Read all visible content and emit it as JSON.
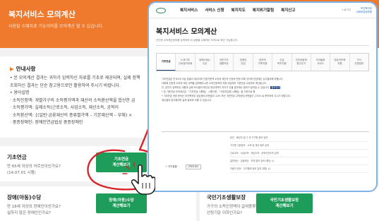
{
  "background_page": {
    "header": {
      "title": "복지서비스 모의계산",
      "subtitle": "사용할 수혜자료 기능이며를 모의계산 할 수 있습니다."
    },
    "guide": {
      "title": "안내사항",
      "lines": [
        "• 본 모의계산 결과는 귀하가 입력하신 자료를 기초로 제공되며, 실제 정책",
        "  조회하신 결과는 단순 참고용으로만 활용하여 주시기 바랍니다.",
        "• 용어설명",
        "  · 소득인정액: 개별가구의 소득평가액과 재산의 소득환산액을 합산한 금",
        "  · 소득평가액: 실제소득(근로소득, 사업소득, 재산소득, 공적이",
        "  · 소득환산액: {(일반·금융재산의 종류별가액 – 기본재산액 – 부채) ×",
        "  · 중증장애인: 장애인연금법상 중증장애인"
      ]
    },
    "cards": [
      {
        "title": "기초연금",
        "desc": "만 65세 이상의 어르신이신가요?\n(14.07.01 시행)",
        "button": "기초연금\n계산해보기"
      },
      {
        "title": "장애(아동)수당",
        "desc": "만 18세 이상의 장애인이신가요?\n실하지 않은 장애인인가요?",
        "button": "장애(아동)수당\n계산해보기"
      },
      {
        "title": "국민기초생활보장",
        "desc": "가구의 소득인정액이 급여종류별\n선정기준 이하인가요?",
        "button": "국민기초생활보장\n계산해보기"
      }
    ]
  },
  "popup": {
    "nav": [
      "복지서비스",
      "서비스 신청",
      "복지지도",
      "복지위기알림",
      "복지신고"
    ],
    "util": "+로그인",
    "brand": "보건복지부\n사회보장정보원",
    "title": "복지서비스 모의계산",
    "subtitle": "간단한 소득재산정보를 입력하여 내 상황을 수혜여부 자격으로 확인 가능합니다.",
    "tabs": [
      "기초연금",
      "노후기초\n근로장려세제",
      "장애(아동)\n수당",
      "국민기초\n생활보장",
      "장애인\n연금",
      "한부모\n가족지원",
      "긴급\n복지지원",
      "주민공동체\n청년주거",
      "아이돌봄\n서비스",
      "영유아보육\n지원",
      "가사\n간병방문"
    ],
    "active_tab": 0,
    "notes": [
      "기초연금은 만 65세 이상 분들이 대상이며 선정기준액 소득과 재산의 인정하 판정 아래 것이며 연금액은 심사결과에 따릅니다.",
      "아래에 선정액 소득과 재산 내역을 입력해주시면 소득인정액과 지원 대상여부 기준연금 수령여부 계산됩니다.",
      "단, 본인이 입력하신 내용과 실제 조사결과 확인된 재산내역이 차이가 있을 경우에는 결과가 달라질 수 있습니다.",
      "* 본 기준연금 모의계산은 「기초연금 시행령」 시행기준,  「국민연금법 시행령」을 기준으로 함",
      "* 기초연금 관련 문의는 보건복지부 상담센터(국번없이 129) 또는 국민연금 고객센터(국번없이 1355) 로 문의하여 주시기 바랍니다.",
      "계산결과 참고용이며 실제 결과와 다를 수 있습니다."
    ],
    "note_highlight": "중요안내",
    "form_rows": [
      "본인 · 배우자 및 그 외 가구원 정보 입력",
      "가구원 기본정보 · 소득 및 재산 정보 입력",
      "근로소득 · 사업소득 · 재산소득 · 공적이전소득 입력",
      "일반재산 · 금융재산 · 부채 정보 입력 (해당 시)",
      "자동차 정보 · 주거형태 정보 입력 (해당 시)"
    ],
    "field_label": "가구유형",
    "field_required_mark": "*",
    "select_value": "선택하세요"
  },
  "colors": {
    "header_orange": "#ef7a2e",
    "button_green": "#1e9c5a",
    "annotation_red": "#d8252b",
    "popup_border": "#7fb3e8",
    "tab_accent": "#1b3f7a"
  }
}
